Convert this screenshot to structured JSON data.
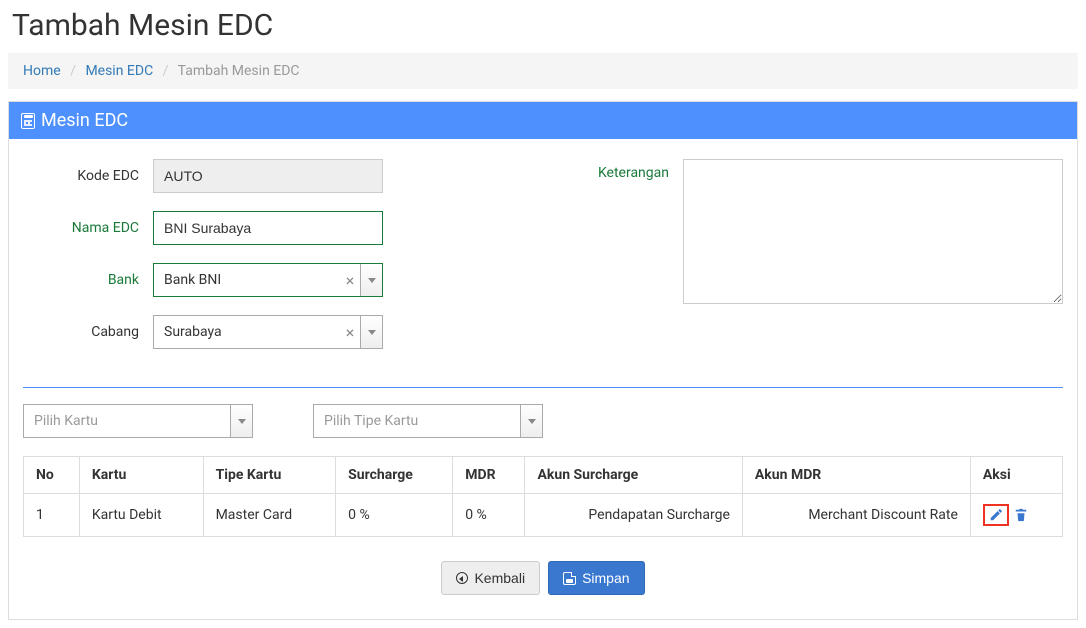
{
  "header": {
    "page_title": "Tambah Mesin EDC"
  },
  "breadcrumb": {
    "home": "Home",
    "mesin_edc": "Mesin EDC",
    "active": "Tambah Mesin EDC"
  },
  "panel": {
    "title": "Mesin EDC"
  },
  "form": {
    "labels": {
      "kode_edc": "Kode EDC",
      "nama_edc": "Nama EDC",
      "bank": "Bank",
      "cabang": "Cabang",
      "keterangan": "Keterangan"
    },
    "values": {
      "kode_edc": "AUTO",
      "nama_edc": "BNI Surabaya",
      "bank": "Bank BNI",
      "cabang": "Surabaya",
      "keterangan": ""
    }
  },
  "filters": {
    "kartu_placeholder": "Pilih Kartu",
    "tipe_placeholder": "Pilih Tipe Kartu"
  },
  "table": {
    "headers": {
      "no": "No",
      "kartu": "Kartu",
      "tipe_kartu": "Tipe Kartu",
      "surcharge": "Surcharge",
      "mdr": "MDR",
      "akun_surcharge": "Akun Surcharge",
      "akun_mdr": "Akun MDR",
      "aksi": "Aksi"
    },
    "rows": [
      {
        "no": "1",
        "kartu": "Kartu Debit",
        "tipe_kartu": "Master Card",
        "surcharge": "0 %",
        "mdr": "0 %",
        "akun_surcharge": "Pendapatan Surcharge",
        "akun_mdr": "Merchant Discount Rate"
      }
    ]
  },
  "buttons": {
    "kembali": "Kembali",
    "simpan": "Simpan"
  }
}
